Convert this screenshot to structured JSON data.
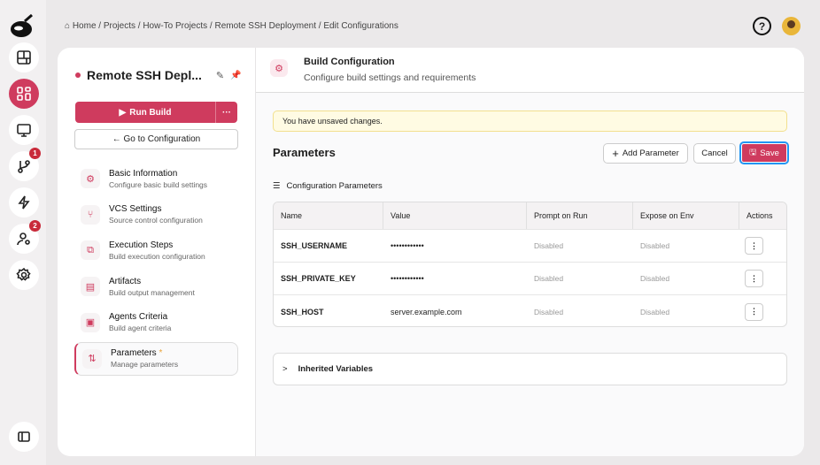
{
  "breadcrumb": [
    "Home",
    "Projects",
    "How-To Projects",
    "Remote SSH Deployment",
    "Edit Configurations"
  ],
  "rail": {
    "badges": {
      "vcs": "1",
      "users": "2"
    }
  },
  "project": {
    "title": "Remote SSH Depl...",
    "run_label": "Run Build",
    "more_label": "···",
    "goto_label": "← Go to Configuration"
  },
  "nav": [
    {
      "title": "Basic Information",
      "sub": "Configure basic build settings",
      "icon": "gear-icon"
    },
    {
      "title": "VCS Settings",
      "sub": "Source control configuration",
      "icon": "branch-icon"
    },
    {
      "title": "Execution Steps",
      "sub": "Build execution configuration",
      "icon": "steps-icon"
    },
    {
      "title": "Artifacts",
      "sub": "Build output management",
      "icon": "file-icon"
    },
    {
      "title": "Agents Criteria",
      "sub": "Build agent criteria",
      "icon": "agent-icon"
    },
    {
      "title": "Parameters",
      "sub": "Manage parameters",
      "icon": "sliders-icon",
      "star": "*"
    }
  ],
  "header": {
    "title": "Build Configuration",
    "subtitle": "Configure build settings and requirements"
  },
  "warning": "You have unsaved changes.",
  "section": {
    "title": "Parameters",
    "add": "Add Parameter",
    "cancel": "Cancel",
    "save": "Save",
    "sub": "Configuration Parameters"
  },
  "table": {
    "headers": [
      "Name",
      "Value",
      "Prompt on Run",
      "Expose on Env",
      "Actions"
    ],
    "rows": [
      {
        "name": "SSH_USERNAME",
        "value": "••••••••••••",
        "prompt": "Disabled",
        "expose": "Disabled"
      },
      {
        "name": "SSH_PRIVATE_KEY",
        "value": "••••••••••••",
        "prompt": "Disabled",
        "expose": "Disabled"
      },
      {
        "name": "SSH_HOST",
        "value": "server.example.com",
        "prompt": "Disabled",
        "expose": "Disabled"
      }
    ]
  },
  "inherited": "Inherited Variables",
  "colors": {
    "accent": "#cf3b5e",
    "warning_bg": "#fffbe3",
    "focus": "#2196f3"
  }
}
